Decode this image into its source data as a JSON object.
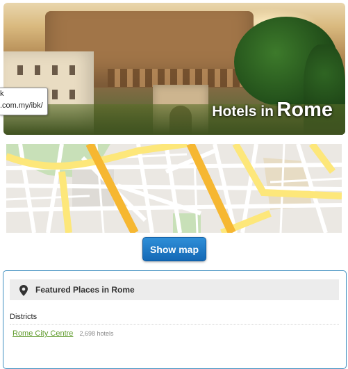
{
  "hero": {
    "title_prefix": "Hotels in",
    "title_city": "Rome"
  },
  "tooltip": {
    "line1": "k",
    "line2": ".com.my/ibk/"
  },
  "map": {
    "show_map_label": "Show map"
  },
  "featured": {
    "icon": "map-pin-icon",
    "title": "Featured Places in Rome",
    "section_label": "Districts",
    "districts": [
      {
        "name": "Rome City Centre",
        "count": "2,698 hotels"
      }
    ]
  },
  "colors": {
    "accent_blue": "#1f7ac6",
    "panel_border": "#3f8fc0",
    "link_green": "#5e9a2a",
    "map_road_major": "#f6b731",
    "map_road_yellow": "#fde77a"
  }
}
